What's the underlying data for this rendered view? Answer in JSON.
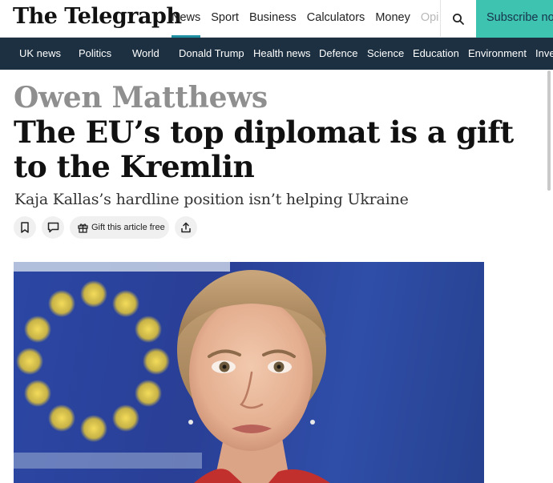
{
  "header": {
    "logo": "The Telegraph",
    "nav": [
      "News",
      "Sport",
      "Business",
      "Calculators",
      "Money",
      "Opi"
    ],
    "search_icon": "search-icon",
    "subscribe_label": "Subscribe no",
    "accent": "#1d8fa0",
    "subscribe_color": "#3ec3b0"
  },
  "secondary_nav": {
    "items": [
      "UK news",
      "Politics",
      "World",
      "Donald Trump",
      "Health news",
      "Defence",
      "Science",
      "Education",
      "Environment",
      "Inve"
    ],
    "background": "#1c3041"
  },
  "article": {
    "author": "Owen Matthews",
    "headline": "The EU’s top diplomat is a gift to the Kremlin",
    "standfirst": "Kaja Kallas’s hardline position isn’t helping Ukraine",
    "actions": {
      "bookmark_icon": "bookmark-icon",
      "comment_icon": "comment-icon",
      "gift_icon": "gift-icon",
      "gift_label": "Gift this article free",
      "share_icon": "share-icon"
    }
  }
}
